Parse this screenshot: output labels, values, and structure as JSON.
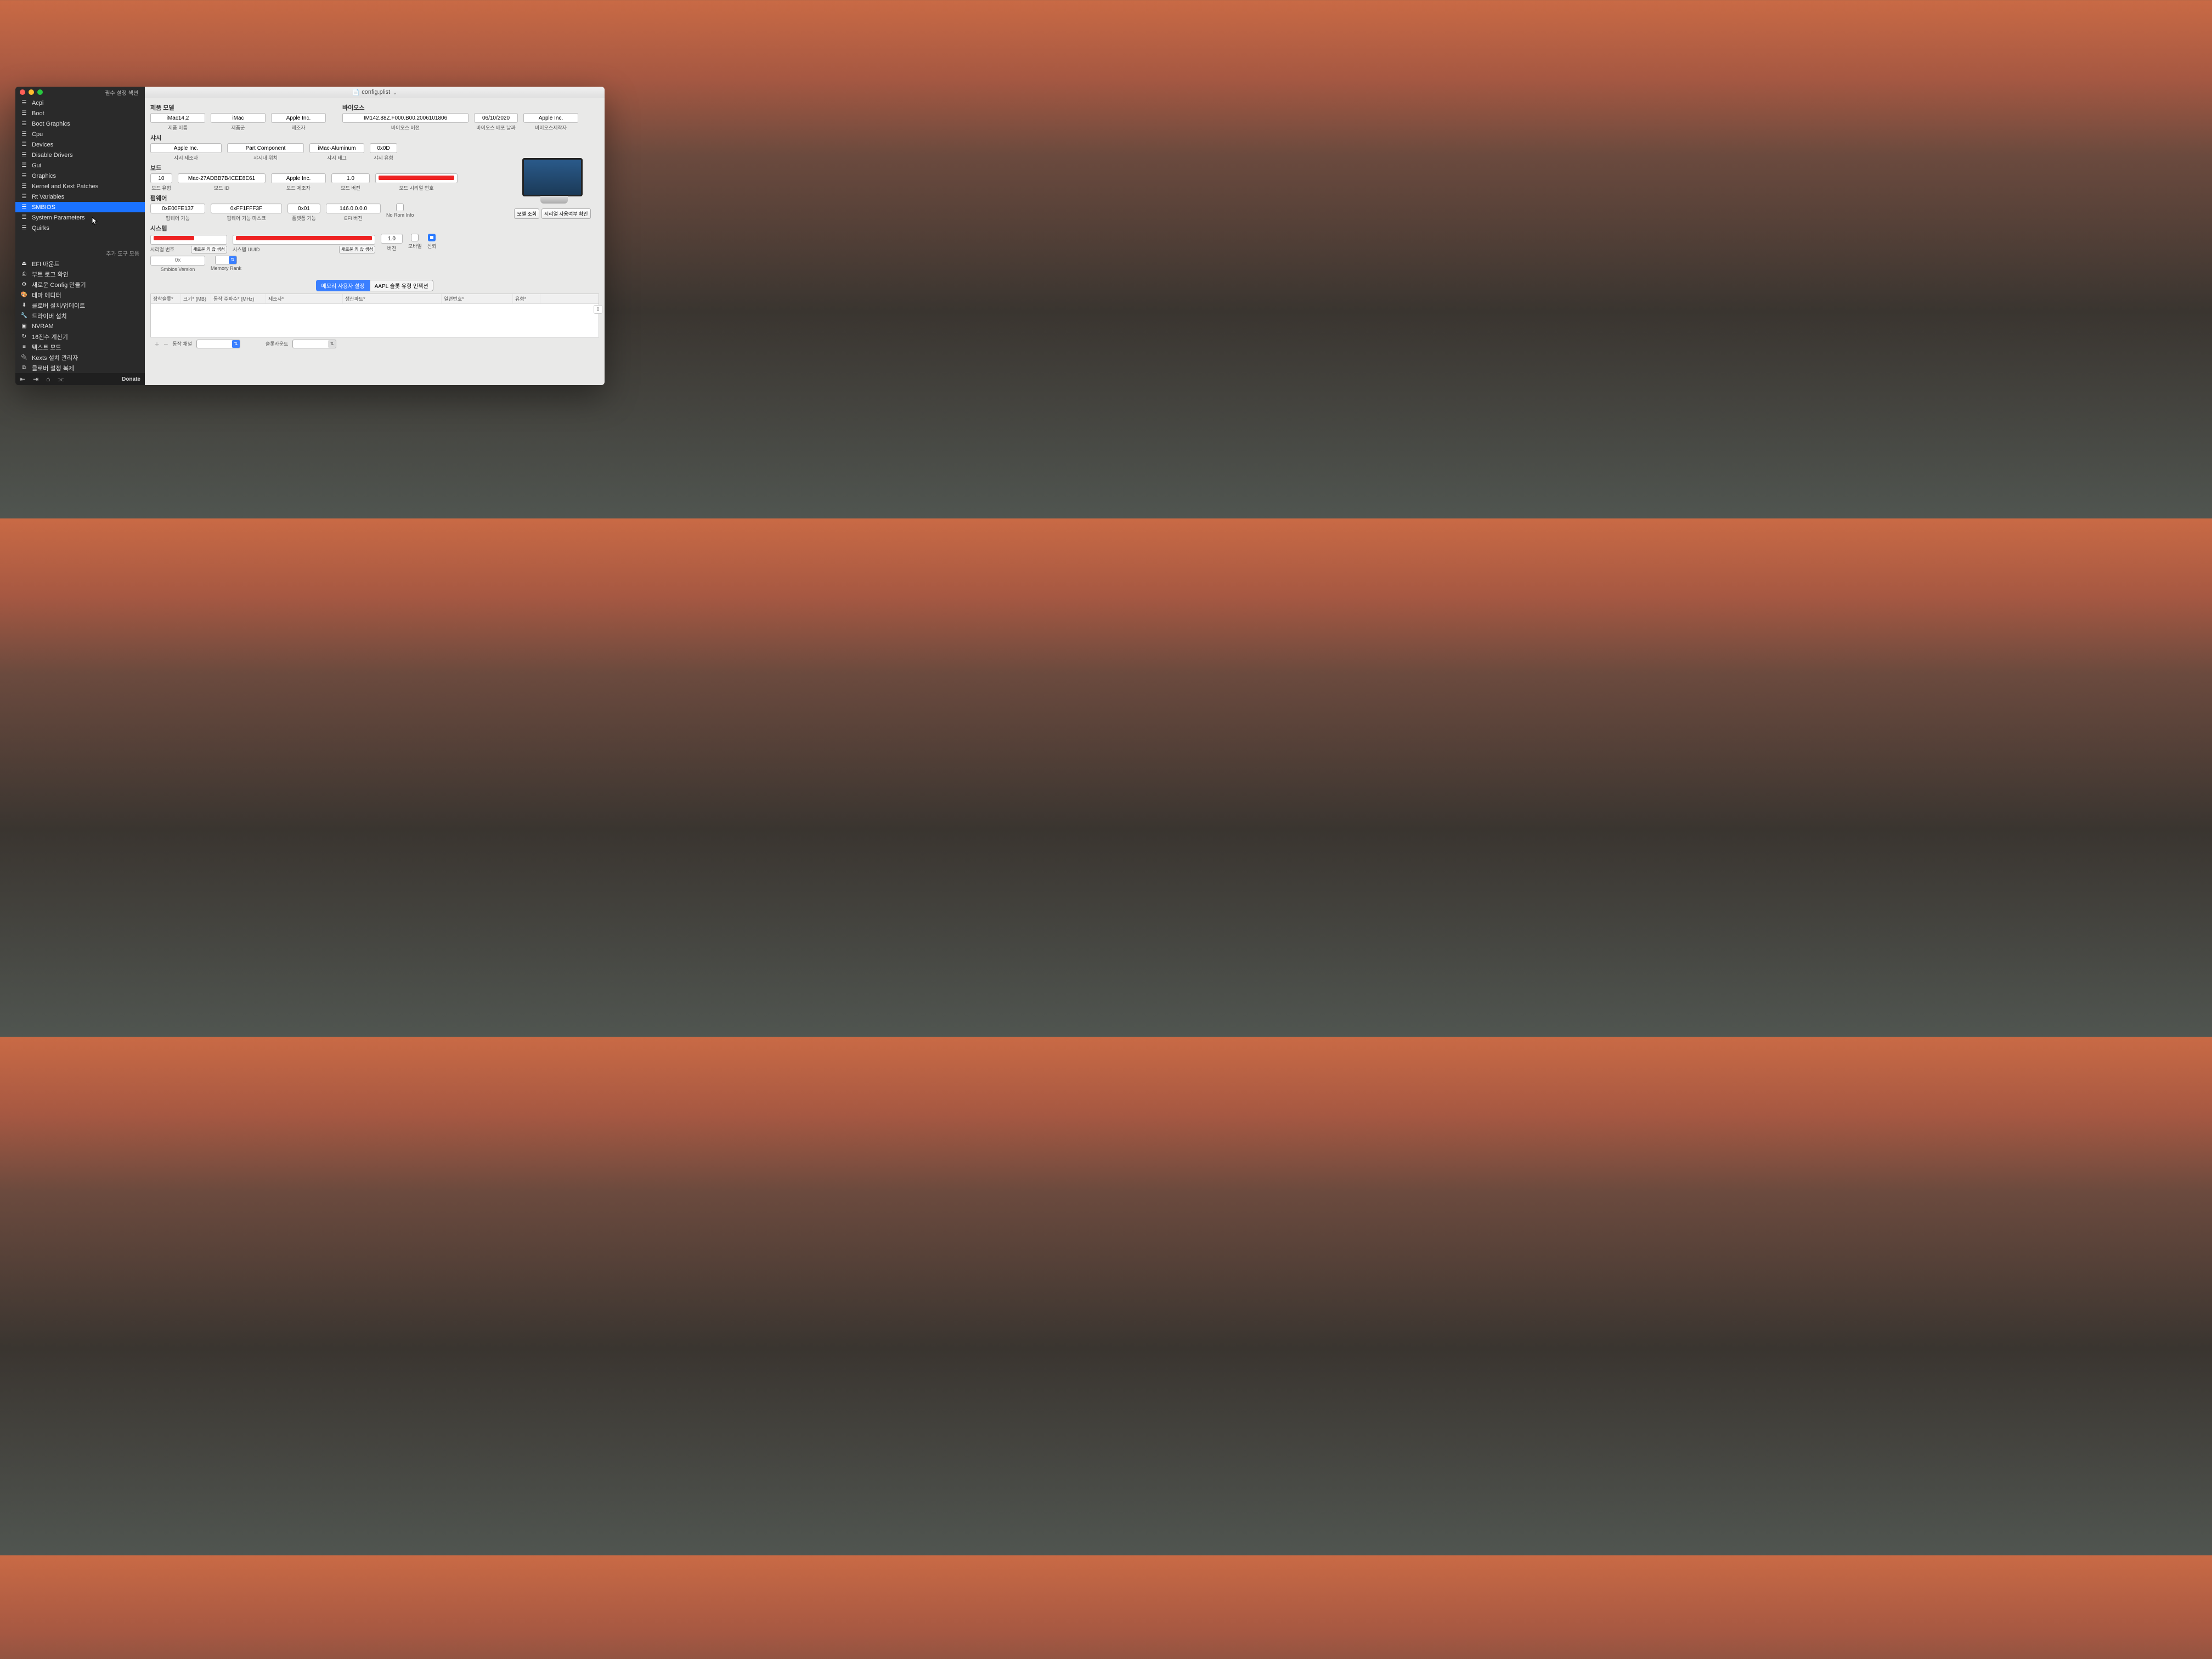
{
  "window": {
    "sidebar_header": "필수 설정 섹션",
    "main_title": "config.plist",
    "extra_tools": "추가 도구 모음"
  },
  "sidebar": {
    "items": [
      {
        "icon": "list",
        "label": "Acpi"
      },
      {
        "icon": "list",
        "label": "Boot"
      },
      {
        "icon": "list",
        "label": "Boot Graphics"
      },
      {
        "icon": "list",
        "label": "Cpu"
      },
      {
        "icon": "list",
        "label": "Devices"
      },
      {
        "icon": "list",
        "label": "Disable Drivers"
      },
      {
        "icon": "list",
        "label": "Gui"
      },
      {
        "icon": "list",
        "label": "Graphics"
      },
      {
        "icon": "list",
        "label": "Kernel and Kext Patches"
      },
      {
        "icon": "list",
        "label": "Rt Variables"
      },
      {
        "icon": "list",
        "label": "SMBIOS",
        "selected": true
      },
      {
        "icon": "list",
        "label": "System Parameters"
      },
      {
        "icon": "list",
        "label": "Quirks"
      }
    ],
    "tools": [
      {
        "icon": "mount",
        "label": "EFI 마운트"
      },
      {
        "icon": "log",
        "label": "부트 로그 확인"
      },
      {
        "icon": "gear",
        "label": "새로운 Config 만들기"
      },
      {
        "icon": "palette",
        "label": "테마 에디터"
      },
      {
        "icon": "download",
        "label": "클로버 설치/업데이트"
      },
      {
        "icon": "wrench",
        "label": "드라이버 설치"
      },
      {
        "icon": "cpu",
        "label": "NVRAM"
      },
      {
        "icon": "cycle",
        "label": "16진수 계산기"
      },
      {
        "icon": "text",
        "label": "텍스트 모드"
      },
      {
        "icon": "plug",
        "label": "Kexts 설치 관리자"
      },
      {
        "icon": "copy",
        "label": "클로버 설정 복제"
      }
    ],
    "footer_donate": "Donate"
  },
  "sections": {
    "product_model": "제품 모델",
    "bios": "바이오스",
    "chassis": "샤시",
    "board": "보드",
    "firmware": "펌웨어",
    "system": "시스템"
  },
  "product": {
    "name": {
      "value": "iMac14,2",
      "label": "제품 이름"
    },
    "family": {
      "value": "iMac",
      "label": "제품군"
    },
    "manufacturer": {
      "value": "Apple Inc.",
      "label": "제조자"
    }
  },
  "bios": {
    "version": {
      "value": "IM142.88Z.F000.B00.2006101806",
      "label": "바이오스 버전"
    },
    "date": {
      "value": "06/10/2020",
      "label": "바이오스 배포 날짜"
    },
    "vendor": {
      "value": "Apple Inc.",
      "label": "바이오스제작자"
    }
  },
  "chassis": {
    "manufacturer": {
      "value": "Apple Inc.",
      "label": "샤시 제조자"
    },
    "location": {
      "value": "Part Component",
      "label": "샤시내 위치"
    },
    "tag": {
      "value": "iMac-Aluminum",
      "label": "샤시 태그"
    },
    "type": {
      "value": "0x0D",
      "label": "샤시 유형"
    }
  },
  "board": {
    "type": {
      "value": "10",
      "label": "보드 유형"
    },
    "id": {
      "value": "Mac-27ADBB7B4CEE8E61",
      "label": "보드 ID"
    },
    "manufacturer": {
      "value": "Apple Inc.",
      "label": "보드 제조자"
    },
    "version": {
      "value": "1.0",
      "label": "보드 버전"
    },
    "serial": {
      "value": "",
      "label": "보드 시리얼 번호",
      "redacted": true
    }
  },
  "firmware": {
    "features": {
      "value": "0xE00FE137",
      "label": "펌웨어 기능"
    },
    "features_mask": {
      "value": "0xFF1FFF3F",
      "label": "펌웨어 기능 마스크"
    },
    "platform": {
      "value": "0x01",
      "label": "플랫폼 기능"
    },
    "efi_version": {
      "value": "146.0.0.0.0",
      "label": "EFI 버전"
    },
    "no_rom_info": {
      "label": "No Rom Info"
    }
  },
  "system": {
    "serial": {
      "value": "",
      "label": "시리얼 번호",
      "redacted": true,
      "button": "새로운 키 값 생성"
    },
    "uuid": {
      "value": "",
      "label": "시스템 UUID",
      "redacted": true,
      "button": "새로운 키 값 생성"
    },
    "version": {
      "value": "1.0",
      "label": "버전"
    },
    "mobile": {
      "label": "모바일"
    },
    "trust": {
      "label": "신뢰"
    },
    "smbios_version": {
      "value": "0x",
      "label": "Smbios Version"
    },
    "memory_rank": {
      "value": "",
      "label": "Memory Rank"
    }
  },
  "preview": {
    "lookup": "모델 조회",
    "check_serial": "시리얼 사용여부 확인"
  },
  "tabs": {
    "memory_user": "메모리 사용자 설정",
    "aapl_slot": "AAPL 슬롯 유형 인젝션"
  },
  "table": {
    "headers": [
      "장착슬롯*",
      "크기* (MB)",
      "동작 주파수* (MHz)",
      "제조사*",
      "생산파트*",
      "일련번호*",
      "유형*"
    ],
    "ch_label": "동작 채널",
    "slot_label": "슬롯카운트"
  }
}
